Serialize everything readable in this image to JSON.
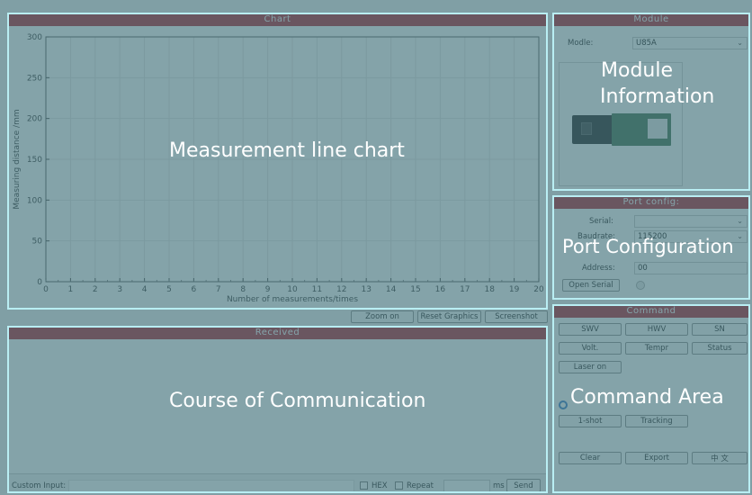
{
  "chart_panel": {
    "title": "Chart"
  },
  "chart_data": {
    "type": "line",
    "x": [],
    "y": [],
    "xlabel": "Number of measurements/times",
    "ylabel": "Measuring distance /mm",
    "xlim": [
      0,
      20
    ],
    "ylim": [
      0,
      300
    ],
    "x_ticks": [
      0,
      1,
      2,
      3,
      4,
      5,
      6,
      7,
      8,
      9,
      10,
      11,
      12,
      13,
      14,
      15,
      16,
      17,
      18,
      19,
      20
    ],
    "y_ticks": [
      0,
      50,
      100,
      150,
      200,
      250,
      300
    ],
    "grid": true
  },
  "chart_buttons": {
    "zoom": "Zoom on",
    "reset": "Reset Graphics",
    "screenshot": "Screenshot"
  },
  "received": {
    "title": "Received"
  },
  "custom_input": {
    "label": "Custom Input:",
    "hex_label": "HEX",
    "repeat_label": "Repeat",
    "ms_label": "ms",
    "send_label": "Send"
  },
  "module": {
    "title": "Module",
    "label": "Modle:",
    "value": "U85A"
  },
  "port": {
    "title": "Port config:",
    "serial_label": "Serial:",
    "serial_value": "",
    "baud_label": "Baudrate:",
    "baud_value": "115200",
    "address_label": "Address:",
    "address_value": "00",
    "open_label": "Open Serial"
  },
  "command": {
    "title": "Command",
    "buttons": [
      "SWV",
      "HWV",
      "SN",
      "Volt.",
      "Tempr",
      "Status",
      "Laser  on"
    ],
    "shot": "1-shot",
    "tracking": "Tracking",
    "clear": "Clear",
    "export": "Export",
    "lang": "中  文"
  },
  "annotations": {
    "chart": "Measurement line chart",
    "comm": "Course of Communication",
    "module": "Module\nInformation",
    "module_line1": "Module",
    "module_line2": "Information",
    "port": "Port Configuration",
    "command": "Command Area"
  },
  "colors": {
    "title_bar": "#b41e2b",
    "overlay": "#45737c",
    "outline": "#b9eef3",
    "radio": "#2f78c8"
  }
}
